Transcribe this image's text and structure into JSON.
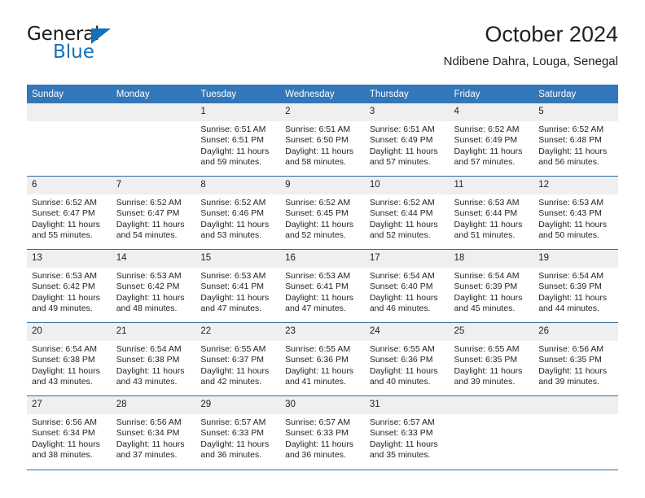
{
  "brand": {
    "name_line1": "General",
    "name_line2": "Blue",
    "accent_color": "#1570bc"
  },
  "header": {
    "title": "October 2024",
    "subtitle": "Ndibene Dahra, Louga, Senegal"
  },
  "theme": {
    "header_bg": "#3277b9",
    "daynum_bg": "#efefef",
    "rule_color": "#2e6da4",
    "text_color": "#231f20"
  },
  "calendar": {
    "weekday_headers": [
      "Sunday",
      "Monday",
      "Tuesday",
      "Wednesday",
      "Thursday",
      "Friday",
      "Saturday"
    ],
    "weeks": [
      [
        {
          "day": "",
          "blank": true,
          "sunrise": "",
          "sunset": "",
          "daylight": ""
        },
        {
          "day": "",
          "blank": true,
          "sunrise": "",
          "sunset": "",
          "daylight": ""
        },
        {
          "day": "1",
          "sunrise": "Sunrise: 6:51 AM",
          "sunset": "Sunset: 6:51 PM",
          "daylight": "Daylight: 11 hours and 59 minutes."
        },
        {
          "day": "2",
          "sunrise": "Sunrise: 6:51 AM",
          "sunset": "Sunset: 6:50 PM",
          "daylight": "Daylight: 11 hours and 58 minutes."
        },
        {
          "day": "3",
          "sunrise": "Sunrise: 6:51 AM",
          "sunset": "Sunset: 6:49 PM",
          "daylight": "Daylight: 11 hours and 57 minutes."
        },
        {
          "day": "4",
          "sunrise": "Sunrise: 6:52 AM",
          "sunset": "Sunset: 6:49 PM",
          "daylight": "Daylight: 11 hours and 57 minutes."
        },
        {
          "day": "5",
          "sunrise": "Sunrise: 6:52 AM",
          "sunset": "Sunset: 6:48 PM",
          "daylight": "Daylight: 11 hours and 56 minutes."
        }
      ],
      [
        {
          "day": "6",
          "sunrise": "Sunrise: 6:52 AM",
          "sunset": "Sunset: 6:47 PM",
          "daylight": "Daylight: 11 hours and 55 minutes."
        },
        {
          "day": "7",
          "sunrise": "Sunrise: 6:52 AM",
          "sunset": "Sunset: 6:47 PM",
          "daylight": "Daylight: 11 hours and 54 minutes."
        },
        {
          "day": "8",
          "sunrise": "Sunrise: 6:52 AM",
          "sunset": "Sunset: 6:46 PM",
          "daylight": "Daylight: 11 hours and 53 minutes."
        },
        {
          "day": "9",
          "sunrise": "Sunrise: 6:52 AM",
          "sunset": "Sunset: 6:45 PM",
          "daylight": "Daylight: 11 hours and 52 minutes."
        },
        {
          "day": "10",
          "sunrise": "Sunrise: 6:52 AM",
          "sunset": "Sunset: 6:44 PM",
          "daylight": "Daylight: 11 hours and 52 minutes."
        },
        {
          "day": "11",
          "sunrise": "Sunrise: 6:53 AM",
          "sunset": "Sunset: 6:44 PM",
          "daylight": "Daylight: 11 hours and 51 minutes."
        },
        {
          "day": "12",
          "sunrise": "Sunrise: 6:53 AM",
          "sunset": "Sunset: 6:43 PM",
          "daylight": "Daylight: 11 hours and 50 minutes."
        }
      ],
      [
        {
          "day": "13",
          "sunrise": "Sunrise: 6:53 AM",
          "sunset": "Sunset: 6:42 PM",
          "daylight": "Daylight: 11 hours and 49 minutes."
        },
        {
          "day": "14",
          "sunrise": "Sunrise: 6:53 AM",
          "sunset": "Sunset: 6:42 PM",
          "daylight": "Daylight: 11 hours and 48 minutes."
        },
        {
          "day": "15",
          "sunrise": "Sunrise: 6:53 AM",
          "sunset": "Sunset: 6:41 PM",
          "daylight": "Daylight: 11 hours and 47 minutes."
        },
        {
          "day": "16",
          "sunrise": "Sunrise: 6:53 AM",
          "sunset": "Sunset: 6:41 PM",
          "daylight": "Daylight: 11 hours and 47 minutes."
        },
        {
          "day": "17",
          "sunrise": "Sunrise: 6:54 AM",
          "sunset": "Sunset: 6:40 PM",
          "daylight": "Daylight: 11 hours and 46 minutes."
        },
        {
          "day": "18",
          "sunrise": "Sunrise: 6:54 AM",
          "sunset": "Sunset: 6:39 PM",
          "daylight": "Daylight: 11 hours and 45 minutes."
        },
        {
          "day": "19",
          "sunrise": "Sunrise: 6:54 AM",
          "sunset": "Sunset: 6:39 PM",
          "daylight": "Daylight: 11 hours and 44 minutes."
        }
      ],
      [
        {
          "day": "20",
          "sunrise": "Sunrise: 6:54 AM",
          "sunset": "Sunset: 6:38 PM",
          "daylight": "Daylight: 11 hours and 43 minutes."
        },
        {
          "day": "21",
          "sunrise": "Sunrise: 6:54 AM",
          "sunset": "Sunset: 6:38 PM",
          "daylight": "Daylight: 11 hours and 43 minutes."
        },
        {
          "day": "22",
          "sunrise": "Sunrise: 6:55 AM",
          "sunset": "Sunset: 6:37 PM",
          "daylight": "Daylight: 11 hours and 42 minutes."
        },
        {
          "day": "23",
          "sunrise": "Sunrise: 6:55 AM",
          "sunset": "Sunset: 6:36 PM",
          "daylight": "Daylight: 11 hours and 41 minutes."
        },
        {
          "day": "24",
          "sunrise": "Sunrise: 6:55 AM",
          "sunset": "Sunset: 6:36 PM",
          "daylight": "Daylight: 11 hours and 40 minutes."
        },
        {
          "day": "25",
          "sunrise": "Sunrise: 6:55 AM",
          "sunset": "Sunset: 6:35 PM",
          "daylight": "Daylight: 11 hours and 39 minutes."
        },
        {
          "day": "26",
          "sunrise": "Sunrise: 6:56 AM",
          "sunset": "Sunset: 6:35 PM",
          "daylight": "Daylight: 11 hours and 39 minutes."
        }
      ],
      [
        {
          "day": "27",
          "sunrise": "Sunrise: 6:56 AM",
          "sunset": "Sunset: 6:34 PM",
          "daylight": "Daylight: 11 hours and 38 minutes."
        },
        {
          "day": "28",
          "sunrise": "Sunrise: 6:56 AM",
          "sunset": "Sunset: 6:34 PM",
          "daylight": "Daylight: 11 hours and 37 minutes."
        },
        {
          "day": "29",
          "sunrise": "Sunrise: 6:57 AM",
          "sunset": "Sunset: 6:33 PM",
          "daylight": "Daylight: 11 hours and 36 minutes."
        },
        {
          "day": "30",
          "sunrise": "Sunrise: 6:57 AM",
          "sunset": "Sunset: 6:33 PM",
          "daylight": "Daylight: 11 hours and 36 minutes."
        },
        {
          "day": "31",
          "sunrise": "Sunrise: 6:57 AM",
          "sunset": "Sunset: 6:33 PM",
          "daylight": "Daylight: 11 hours and 35 minutes."
        },
        {
          "day": "",
          "blank": true,
          "sunrise": "",
          "sunset": "",
          "daylight": ""
        },
        {
          "day": "",
          "blank": true,
          "sunrise": "",
          "sunset": "",
          "daylight": ""
        }
      ]
    ]
  }
}
